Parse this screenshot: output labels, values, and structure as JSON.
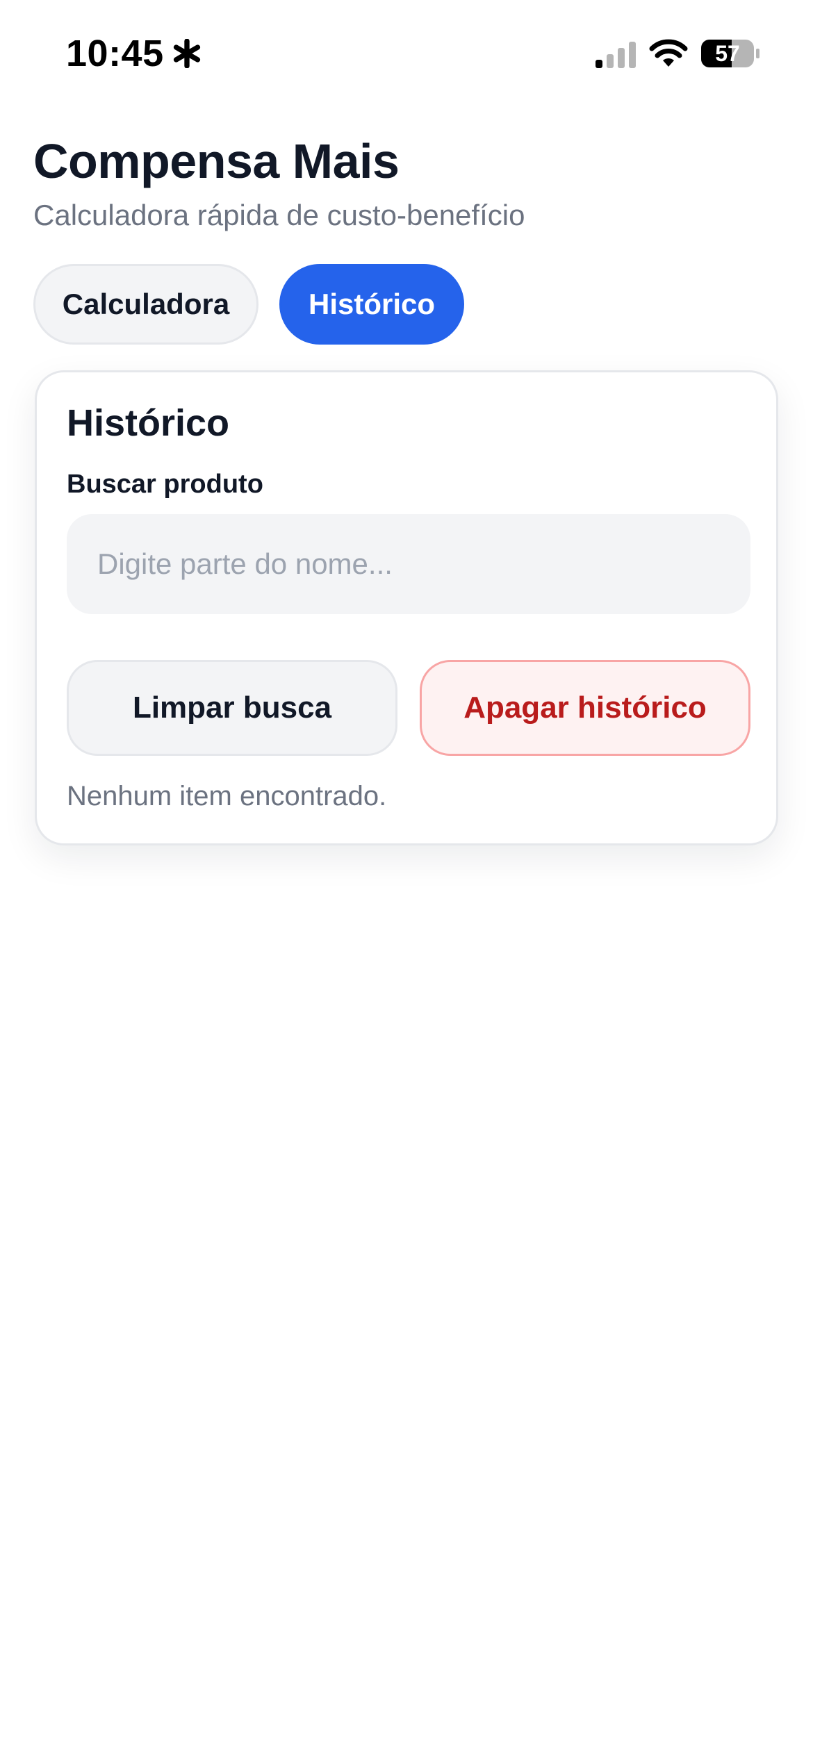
{
  "status_bar": {
    "time": "10:45",
    "battery_level": "57",
    "icons": [
      "asterisk-icon",
      "cellular-signal-icon",
      "wifi-icon",
      "battery-icon"
    ]
  },
  "header": {
    "title": "Compensa Mais",
    "subtitle": "Calculadora rápida de custo-benefício"
  },
  "tabs": [
    {
      "label": "Calculadora",
      "active": false
    },
    {
      "label": "Histórico",
      "active": true
    }
  ],
  "history": {
    "title": "Histórico",
    "search_label": "Buscar produto",
    "search_value": "",
    "search_placeholder": "Digite parte do nome...",
    "clear_button": "Limpar busca",
    "delete_button": "Apagar histórico",
    "empty_message": "Nenhum item encontrado."
  },
  "colors": {
    "accent": "#2563eb",
    "danger": "#b91c1c",
    "danger_bg": "#fef2f2",
    "text_primary": "#111827",
    "text_muted": "#6b7280"
  }
}
